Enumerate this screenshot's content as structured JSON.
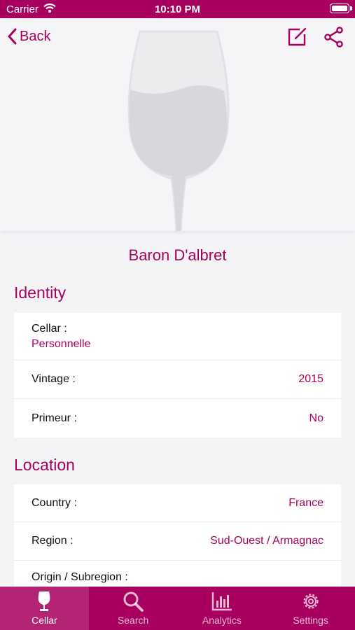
{
  "status_bar": {
    "carrier": "Carrier",
    "time": "10:10 PM"
  },
  "nav": {
    "back_label": "Back"
  },
  "wine": {
    "name": "Baron D'albret"
  },
  "identity": {
    "title": "Identity",
    "rows": [
      {
        "label": "Cellar :",
        "value": "Personnelle"
      },
      {
        "label": "Vintage :",
        "value": "2015"
      },
      {
        "label": "Primeur :",
        "value": "No"
      }
    ]
  },
  "location": {
    "title": "Location",
    "rows": [
      {
        "label": "Country :",
        "value": "France"
      },
      {
        "label": "Region :",
        "value": "Sud-Ouest / Armagnac"
      },
      {
        "label": "Origin / Subregion :",
        "value": ""
      }
    ]
  },
  "tabs": [
    {
      "label": "Cellar",
      "icon": "wine-glass-icon",
      "active": true
    },
    {
      "label": "Search",
      "icon": "search-icon",
      "active": false
    },
    {
      "label": "Analytics",
      "icon": "analytics-icon",
      "active": false
    },
    {
      "label": "Settings",
      "icon": "gear-icon",
      "active": false
    }
  ],
  "colors": {
    "accent": "#a8005f",
    "background": "#f4f4f7",
    "placeholder_glass": "#d8d8dc"
  }
}
